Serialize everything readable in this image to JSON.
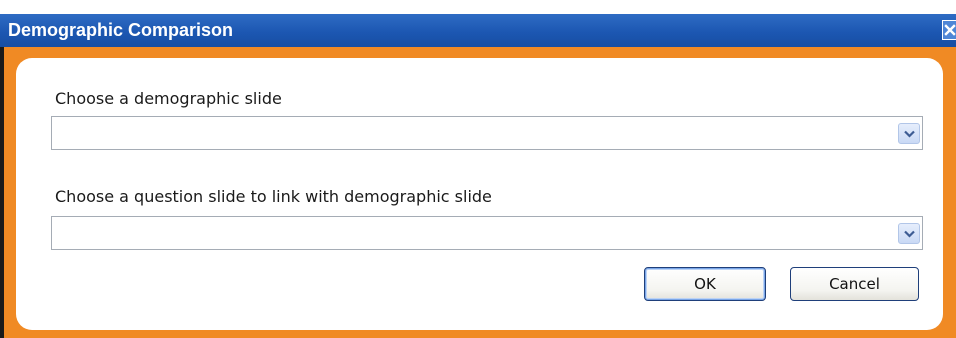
{
  "window": {
    "title": "Demographic Comparison",
    "close_icon": "close-icon"
  },
  "form": {
    "demographic_label": "Choose a demographic slide",
    "demographic_value": "",
    "question_label": "Choose a question slide to link with demographic slide",
    "question_value": ""
  },
  "buttons": {
    "ok_label": "OK",
    "cancel_label": "Cancel"
  },
  "colors": {
    "titlebar": "#1c57b2",
    "frame": "#f08a24",
    "panel": "#ffffff"
  }
}
